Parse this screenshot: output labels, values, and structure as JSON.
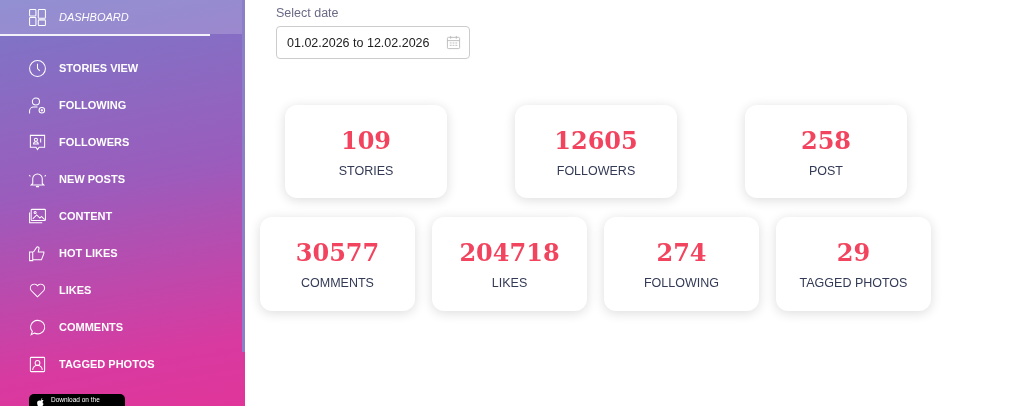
{
  "sidebar": {
    "items": [
      {
        "label": "DASHBOARD",
        "selected": true
      },
      {
        "label": "STORIES VIEW",
        "selected": false
      },
      {
        "label": "FOLLOWING",
        "selected": false
      },
      {
        "label": "FOLLOWERS",
        "selected": false
      },
      {
        "label": "NEW POSTS",
        "selected": false
      },
      {
        "label": "CONTENT",
        "selected": false
      },
      {
        "label": "HOT LIKES",
        "selected": false
      },
      {
        "label": "LIKES",
        "selected": false
      },
      {
        "label": "COMMENTS",
        "selected": false
      },
      {
        "label": "TAGGED PHOTOS",
        "selected": false
      }
    ],
    "store_badge": {
      "text": "Download on the"
    }
  },
  "date_filter": {
    "label": "Select date",
    "value": "01.02.2026 to 12.02.2026"
  },
  "stats_rows": [
    [
      {
        "value": "109",
        "label": "STORIES"
      },
      {
        "value": "12605",
        "label": "FOLLOWERS"
      },
      {
        "value": "258",
        "label": "POST"
      }
    ],
    [
      {
        "value": "30577",
        "label": "COMMENTS"
      },
      {
        "value": "204718",
        "label": "LIKES"
      },
      {
        "value": "274",
        "label": "FOLLOWING"
      },
      {
        "value": "29",
        "label": "TAGGED PHOTOS"
      }
    ]
  ]
}
